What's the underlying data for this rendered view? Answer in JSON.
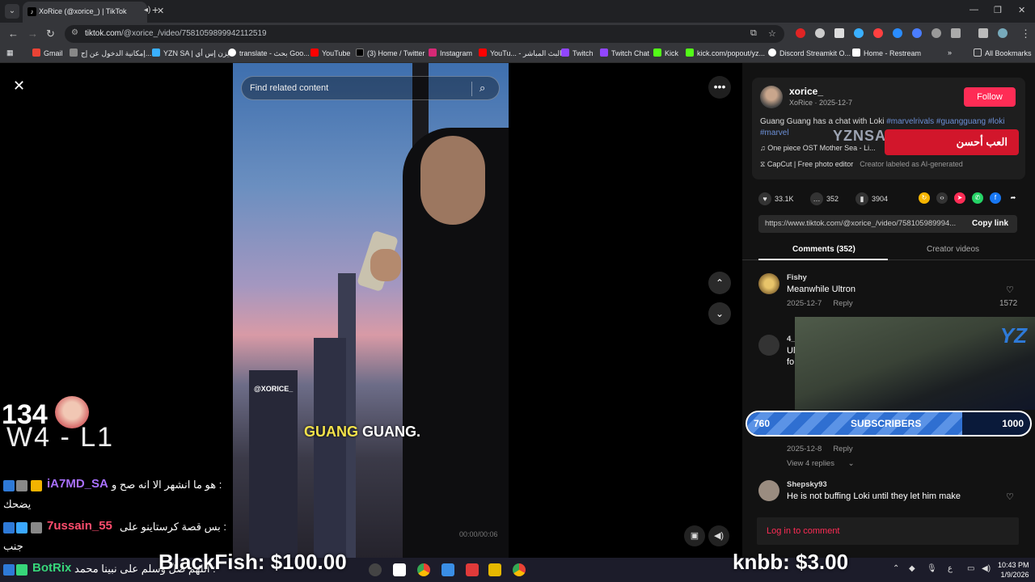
{
  "browser": {
    "tab_title": "XoRice (@xorice_) | TikTok",
    "url_host": "tiktok.com",
    "url_path": "/@xorice_/video/7581059899942112519",
    "bookmarks": [
      "Gmail",
      "إمكانية الدخول عن إج...",
      "YZN SA | يزن إس أي",
      "translate - بحث Goo...",
      "YouTube",
      "(3) Home / Twitter",
      "Instagram",
      "YouTu... - البث المباشر",
      "Twitch",
      "Twitch Chat",
      "Kick",
      "kick.com/popout/yz...",
      "Discord Streamkit O...",
      "Home - Restream"
    ],
    "all_bookmarks": "All Bookmarks"
  },
  "video": {
    "search_placeholder": "Find related content",
    "watermark": "@XORICE_",
    "caption_highlight": "GUANG",
    "caption_rest": " GUANG.",
    "time": "00:00/00:06"
  },
  "post": {
    "username": "xorice_",
    "subline": "XoRice · 2025-12-7",
    "follow_label": "Follow",
    "desc_text": "Guang Guang has a chat with Loki ",
    "tags": [
      "#marvelrivals",
      "#guangguang",
      "#loki",
      "#marvel"
    ],
    "music": "One piece OST Mother Sea - Li...",
    "editor": "CapCut | Free photo editor",
    "ai_label": "Creator labeled as AI-generated",
    "likes": "33.1K",
    "comments_count": "352",
    "saves": "3904",
    "share_url": "https://www.tiktok.com/@xorice_/video/758105989994...",
    "copy_link": "Copy link"
  },
  "tabs": {
    "comments": "Comments (352)",
    "creator_videos": "Creator videos"
  },
  "comments": [
    {
      "name": "Fishy",
      "text": "Meanwhile Ultron",
      "date": "2025-12-7",
      "reply": "Reply",
      "likes": "1572"
    },
    {
      "name": "4_",
      "text": "Ul",
      "text2": "fo",
      "date": "2025-12-8",
      "reply": "Reply",
      "view_replies": "View 4 replies"
    },
    {
      "name": "Shepsky93",
      "text": "He is not buffing Loki until they let him make"
    }
  ],
  "login_label": "Log in to comment",
  "overlays": {
    "store_text": "YZNSASTORE",
    "store_ar": "العب أحسن",
    "gameclip_logo": "YZ",
    "score": "134",
    "win_loss": "W4 - L1",
    "subs_current": "760",
    "subs_label": "SUBSCRIBERS",
    "subs_goal": "1000",
    "subs_progress": 0.76,
    "donation_left": "BlackFish: $100.00",
    "donation_right": "knbb: $3.00",
    "chat": [
      {
        "user": "iA7MD_SA",
        "msg": "هو ما انشهر الا انه صح و :",
        "cont": "يضحك",
        "color": "#a970ff"
      },
      {
        "user": "7ussain_55",
        "msg": "بس قصة كرستاينو على :",
        "cont": "جنب",
        "color": "#ff4d6d"
      },
      {
        "user": "BotRix",
        "msg": "اللهم صلّ وسلم على نبينا محمد :",
        "color": "#37d67a"
      }
    ]
  },
  "taskbar": {
    "time": "10:43 PM",
    "date": "1/9/2026",
    "lang": "ع"
  },
  "colors": {
    "tiktok_red": "#fe2c55",
    "tag_blue": "#6b8fd6",
    "subs_blue": "#2f6fd1"
  }
}
